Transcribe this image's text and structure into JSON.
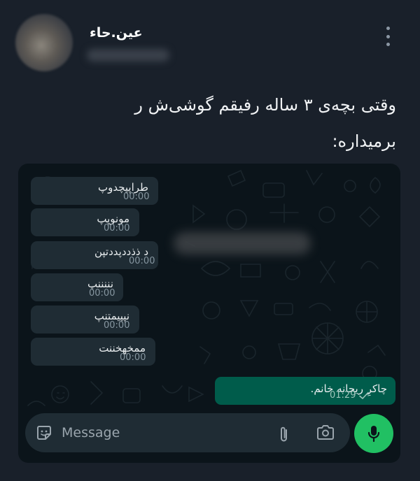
{
  "tweet": {
    "author_name": "عین.حاء",
    "text_line1": "وقتی بچه‌ی ۳ ساله رفیقم گوشی‌ش ر",
    "text_line2": "برمیداره:"
  },
  "chat": {
    "incoming": [
      {
        "text": "طراپپچدوپ",
        "time": "00:00"
      },
      {
        "text": "مونوپپ",
        "time": "00:00"
      },
      {
        "text": "د ذذددپددتپن",
        "time": "00:00"
      },
      {
        "text": "نننننپ",
        "time": "00:00"
      },
      {
        "text": "نپپیمتنپ",
        "time": "00:00"
      },
      {
        "text": "ممخهخننت",
        "time": "00:00"
      }
    ],
    "outgoing": {
      "text": "چاکرِ ریحانه خانم.",
      "time": "01:29"
    },
    "input": {
      "placeholder": "Message"
    }
  },
  "colors": {
    "background": "#19202a",
    "chat_background": "#0b141a",
    "incoming_bubble": "#1f2c34",
    "outgoing_bubble": "#005c4b",
    "mic_button": "#21c063"
  },
  "icons": [
    "more-vertical-icon",
    "sticker-icon",
    "attach-icon",
    "camera-icon",
    "mic-icon",
    "check-icon"
  ]
}
